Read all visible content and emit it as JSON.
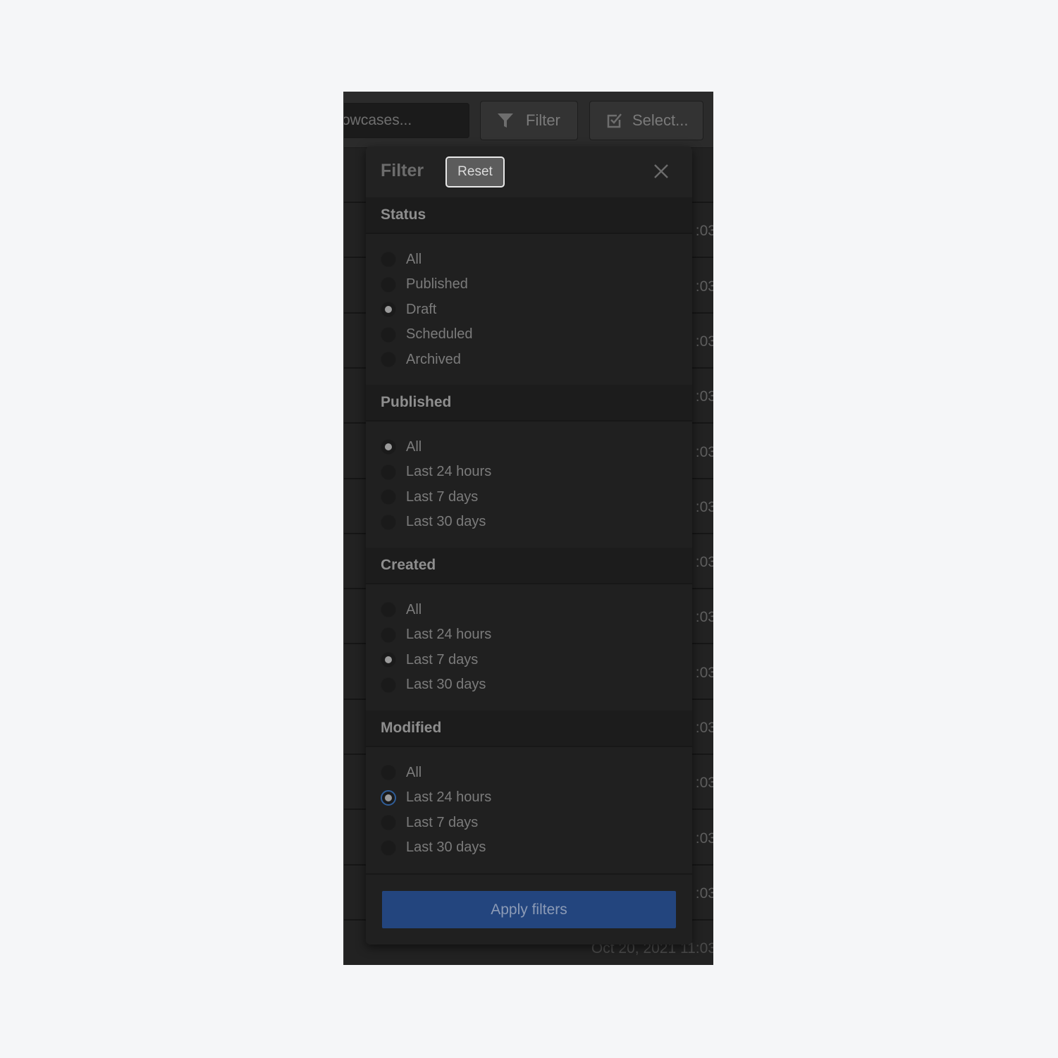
{
  "toolbar": {
    "search_placeholder": "owcases...",
    "filter_label": "Filter",
    "select_label": "Select..."
  },
  "background_rows": {
    "time_fragment": ":03",
    "last_row_text": "Oct 20, 2021 11:03"
  },
  "panel": {
    "title": "Filter",
    "reset_label": "Reset",
    "apply_label": "Apply filters",
    "sections": [
      {
        "heading": "Status",
        "options": [
          {
            "label": "All",
            "selected": false
          },
          {
            "label": "Published",
            "selected": false
          },
          {
            "label": "Draft",
            "selected": true
          },
          {
            "label": "Scheduled",
            "selected": false
          },
          {
            "label": "Archived",
            "selected": false
          }
        ]
      },
      {
        "heading": "Published",
        "options": [
          {
            "label": "All",
            "selected": true
          },
          {
            "label": "Last 24 hours",
            "selected": false
          },
          {
            "label": "Last 7 days",
            "selected": false
          },
          {
            "label": "Last 30 days",
            "selected": false
          }
        ]
      },
      {
        "heading": "Created",
        "options": [
          {
            "label": "All",
            "selected": false
          },
          {
            "label": "Last 24 hours",
            "selected": false
          },
          {
            "label": "Last 7 days",
            "selected": true
          },
          {
            "label": "Last 30 days",
            "selected": false
          }
        ]
      },
      {
        "heading": "Modified",
        "options": [
          {
            "label": "All",
            "selected": false
          },
          {
            "label": "Last 24 hours",
            "selected": true,
            "focused": true
          },
          {
            "label": "Last 7 days",
            "selected": false
          },
          {
            "label": "Last 30 days",
            "selected": false
          }
        ]
      }
    ]
  },
  "colors": {
    "accent": "#23457e",
    "focus_ring": "#2f5d98"
  }
}
